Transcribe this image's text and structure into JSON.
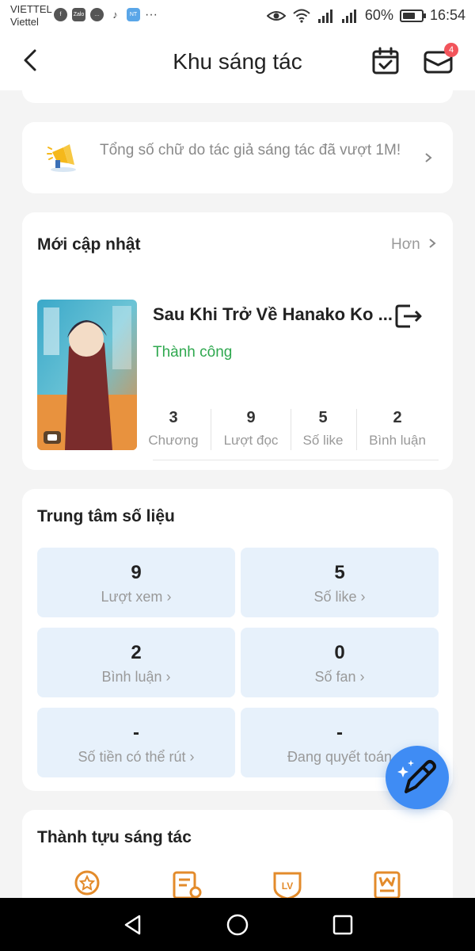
{
  "status_bar": {
    "carrier_1": "VIETTEL",
    "carrier_2": "Viettel",
    "app_icons": [
      "facebook-icon",
      "zalo-icon",
      "chat-icon",
      "tiktok-icon",
      "novel-toon-icon"
    ],
    "zalo": "Zalo",
    "battery": "60%",
    "time": "16:54"
  },
  "header": {
    "title": "Khu sáng tác",
    "mail_badge": "4"
  },
  "notice": {
    "text": "Tổng số chữ do tác giả  sáng tác đã vượt 1M!"
  },
  "recent": {
    "title": "Mới cập nhật",
    "more": "Hơn",
    "book": {
      "title": "Sau Khi Trở Về Hanako Ko ...",
      "status": "Thành công",
      "stats": [
        {
          "value": "3",
          "label": "Chương"
        },
        {
          "value": "9",
          "label": "Lượt đọc"
        },
        {
          "value": "5",
          "label": "Số like"
        },
        {
          "value": "2",
          "label": "Bình luận"
        }
      ]
    }
  },
  "data_center": {
    "title": "Trung tâm số liệu",
    "tiles": [
      {
        "value": "9",
        "label": "Lượt xem"
      },
      {
        "value": "5",
        "label": "Số like"
      },
      {
        "value": "2",
        "label": "Bình luận"
      },
      {
        "value": "0",
        "label": "Số fan"
      },
      {
        "value": "-",
        "label": "Số tiền có thể rút"
      },
      {
        "value": "-",
        "label": "Đang quyết toán"
      }
    ]
  },
  "achievements": {
    "title": "Thành tựu sáng tác"
  },
  "colors": {
    "accent": "#3f8cf4",
    "success": "#2fa84f",
    "badge": "#f2545b",
    "tile_bg": "#e7f1fb"
  }
}
